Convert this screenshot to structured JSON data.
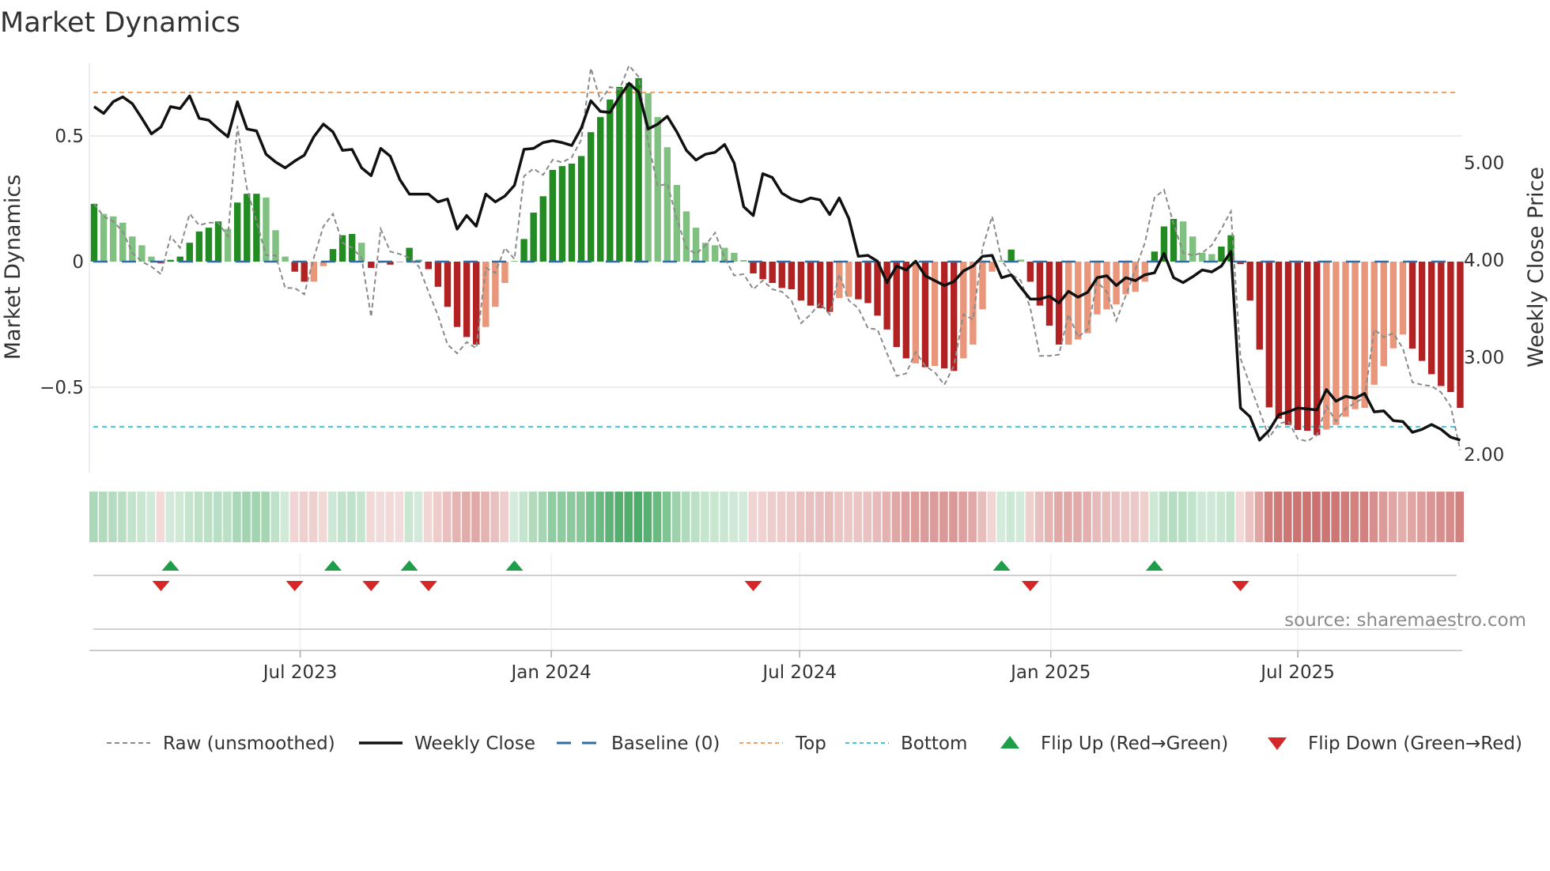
{
  "title": "Market Dynamics",
  "source": "source: sharemaestro.com",
  "colors": {
    "pos_strong": "#228b22",
    "pos_weak": "#80c080",
    "neg_strong": "#b22222",
    "neg_weak": "#e9967a",
    "raw": "#8a8a8a",
    "close": "#111111",
    "baseline": "#2e6fa3",
    "top": "#f0a060",
    "bottom": "#3fc8dc",
    "flip_up": "#1e9e48",
    "flip_down": "#d62728",
    "heat_pos": "#2e9e4f",
    "heat_neg": "#c0504d"
  },
  "chart_data": {
    "type": "bar",
    "title": "Market Dynamics",
    "ylabel": "Market Dynamics",
    "y2label": "Weekly Close Price",
    "ylim": [
      -0.79,
      0.79
    ],
    "y2lim": [
      1.93,
      6.02
    ],
    "yticks": [
      {
        "v": 0.5,
        "label": "0.5"
      },
      {
        "v": 0,
        "label": "0"
      },
      {
        "v": -0.5,
        "label": "−0.5"
      }
    ],
    "y2ticks": [
      {
        "v": 5,
        "label": "5.00"
      },
      {
        "v": 4,
        "label": "4.00"
      },
      {
        "v": 3,
        "label": "3.00"
      },
      {
        "v": 2,
        "label": "2.00"
      }
    ],
    "xticks": [
      {
        "date": "2023-07-01",
        "label": "Jul 2023"
      },
      {
        "date": "2024-01-01",
        "label": "Jan 2024"
      },
      {
        "date": "2024-07-01",
        "label": "Jul 2024"
      },
      {
        "date": "2025-01-01",
        "label": "Jan 2025"
      },
      {
        "date": "2025-07-01",
        "label": "Jul 2025"
      }
    ],
    "start_date": "2023-01-31",
    "interval": "weekly",
    "top_level": 0.673,
    "bottom_level": -0.657,
    "baseline": 0,
    "dynamics": [
      0.23,
      0.19,
      0.18,
      0.155,
      0.1,
      0.065,
      0.02,
      -0.007,
      0.007,
      0.02,
      0.075,
      0.12,
      0.135,
      0.16,
      0.13,
      0.235,
      0.27,
      0.27,
      0.255,
      0.125,
      0.02,
      -0.04,
      -0.08,
      -0.08,
      -0.018,
      0.05,
      0.105,
      0.11,
      0.075,
      -0.025,
      -0.005,
      -0.012,
      -0.003,
      0.055,
      0.008,
      -0.03,
      -0.1,
      -0.18,
      -0.26,
      -0.3,
      -0.33,
      -0.26,
      -0.18,
      -0.085,
      0.003,
      0.09,
      0.195,
      0.26,
      0.365,
      0.38,
      0.39,
      0.42,
      0.515,
      0.575,
      0.645,
      0.695,
      0.71,
      0.73,
      0.67,
      0.575,
      0.455,
      0.305,
      0.2,
      0.135,
      0.075,
      0.065,
      0.055,
      0.035,
      0.006,
      -0.047,
      -0.07,
      -0.085,
      -0.105,
      -0.11,
      -0.155,
      -0.175,
      -0.185,
      -0.2,
      -0.145,
      -0.14,
      -0.15,
      -0.165,
      -0.215,
      -0.27,
      -0.34,
      -0.385,
      -0.405,
      -0.42,
      -0.415,
      -0.425,
      -0.435,
      -0.385,
      -0.33,
      -0.19,
      -0.04,
      0.005,
      0.048,
      0.008,
      -0.08,
      -0.175,
      -0.255,
      -0.33,
      -0.33,
      -0.31,
      -0.285,
      -0.21,
      -0.19,
      -0.17,
      -0.13,
      -0.12,
      -0.08,
      0.04,
      0.14,
      0.17,
      0.16,
      0.1,
      0.035,
      0.03,
      0.06,
      0.105,
      -0.01,
      -0.155,
      -0.35,
      -0.58,
      -0.625,
      -0.65,
      -0.67,
      -0.673,
      -0.69,
      -0.668,
      -0.65,
      -0.617,
      -0.587,
      -0.582,
      -0.49,
      -0.416,
      -0.345,
      -0.29,
      -0.346,
      -0.395,
      -0.448,
      -0.495,
      -0.519,
      -0.582
    ],
    "strong": [
      1,
      0,
      0,
      0,
      0,
      0,
      0,
      1,
      1,
      1,
      1,
      1,
      1,
      1,
      0,
      1,
      1,
      1,
      0,
      0,
      0,
      1,
      1,
      0,
      0,
      1,
      1,
      1,
      0,
      1,
      0,
      1,
      0,
      1,
      0,
      1,
      1,
      1,
      1,
      1,
      1,
      0,
      0,
      0,
      0,
      1,
      1,
      1,
      1,
      1,
      1,
      1,
      1,
      1,
      1,
      1,
      1,
      1,
      0,
      0,
      0,
      0,
      0,
      0,
      0,
      0,
      0,
      0,
      0,
      1,
      1,
      1,
      1,
      1,
      1,
      1,
      1,
      1,
      0,
      0,
      1,
      1,
      1,
      1,
      1,
      1,
      0,
      1,
      0,
      1,
      1,
      0,
      0,
      0,
      0,
      0,
      1,
      0,
      1,
      1,
      1,
      1,
      0,
      0,
      0,
      0,
      0,
      0,
      0,
      0,
      0,
      1,
      1,
      1,
      0,
      0,
      0,
      0,
      1,
      1,
      1,
      1,
      1,
      1,
      1,
      1,
      1,
      1,
      1,
      0,
      0,
      0,
      0,
      0,
      0,
      0,
      0,
      0,
      1,
      1,
      1,
      1,
      1,
      1
    ],
    "raw": [
      0.23,
      0.18,
      0.16,
      0.12,
      0.035,
      0,
      -0.02,
      -0.05,
      0.1,
      0.055,
      0.19,
      0.145,
      0.155,
      0.155,
      0.1,
      0.54,
      0.29,
      0.16,
      0.025,
      0.025,
      -0.105,
      -0.105,
      -0.13,
      0.015,
      0.14,
      0.19,
      0.075,
      0.055,
      0.015,
      -0.22,
      0.13,
      0.04,
      0.03,
      0.015,
      -0.02,
      -0.12,
      -0.215,
      -0.33,
      -0.365,
      -0.32,
      -0.345,
      -0.025,
      -0.045,
      0.055,
      0.01,
      0.34,
      0.37,
      0.345,
      0.405,
      0.395,
      0.415,
      0.485,
      0.77,
      0.64,
      0.695,
      0.685,
      0.78,
      0.735,
      0.475,
      0.3,
      0.31,
      0.17,
      0.055,
      0.03,
      0.065,
      0.115,
      0.015,
      -0.055,
      -0.05,
      -0.11,
      -0.075,
      -0.11,
      -0.12,
      -0.155,
      -0.245,
      -0.21,
      -0.165,
      -0.21,
      -0.05,
      -0.155,
      -0.185,
      -0.265,
      -0.27,
      -0.365,
      -0.455,
      -0.445,
      -0.36,
      -0.415,
      -0.44,
      -0.49,
      -0.415,
      -0.21,
      -0.23,
      0.055,
      0.18,
      0.005,
      -0.05,
      -0.075,
      -0.185,
      -0.375,
      -0.375,
      -0.37,
      -0.21,
      -0.3,
      -0.27,
      -0.08,
      -0.12,
      -0.235,
      -0.135,
      -0.03,
      0.075,
      0.255,
      0.285,
      0.15,
      0.035,
      0.025,
      0.035,
      0.065,
      0.13,
      0.2,
      -0.385,
      -0.49,
      -0.595,
      -0.7,
      -0.645,
      -0.635,
      -0.705,
      -0.715,
      -0.69,
      -0.575,
      -0.635,
      -0.585,
      -0.562,
      -0.54,
      -0.27,
      -0.3,
      -0.285,
      -0.345,
      -0.48,
      -0.49,
      -0.495,
      -0.52,
      -0.575,
      -0.75
    ],
    "weekly_close": [
      5.57,
      5.5,
      5.62,
      5.67,
      5.6,
      5.45,
      5.29,
      5.36,
      5.57,
      5.55,
      5.68,
      5.45,
      5.43,
      5.34,
      5.26,
      5.62,
      5.34,
      5.32,
      5.08,
      5.0,
      4.94,
      5.01,
      5.07,
      5.26,
      5.39,
      5.31,
      5.12,
      5.13,
      4.94,
      4.86,
      5.14,
      5.06,
      4.82,
      4.67,
      4.67,
      4.67,
      4.59,
      4.62,
      4.31,
      4.45,
      4.34,
      4.67,
      4.59,
      4.65,
      4.76,
      5.13,
      5.14,
      5.2,
      5.22,
      5.2,
      5.17,
      5.35,
      5.63,
      5.52,
      5.51,
      5.67,
      5.81,
      5.72,
      5.34,
      5.39,
      5.47,
      5.31,
      5.12,
      5.02,
      5.08,
      5.1,
      5.18,
      4.99,
      4.54,
      4.45,
      4.88,
      4.84,
      4.68,
      4.62,
      4.59,
      4.63,
      4.61,
      4.46,
      4.63,
      4.42,
      4.03,
      4.04,
      3.98,
      3.76,
      3.93,
      3.89,
      3.98,
      3.83,
      3.78,
      3.73,
      3.77,
      3.88,
      3.93,
      4.03,
      4.04,
      3.81,
      3.84,
      3.71,
      3.59,
      3.59,
      3.62,
      3.55,
      3.67,
      3.61,
      3.66,
      3.81,
      3.83,
      3.73,
      3.81,
      3.78,
      3.84,
      3.86,
      4.06,
      3.81,
      3.76,
      3.82,
      3.89,
      3.87,
      3.93,
      4.08,
      2.47,
      2.38,
      2.14,
      2.24,
      2.4,
      2.43,
      2.47,
      2.46,
      2.45,
      2.66,
      2.54,
      2.59,
      2.57,
      2.62,
      2.43,
      2.44,
      2.34,
      2.33,
      2.22,
      2.25,
      2.3,
      2.25,
      2.17,
      2.14
    ],
    "flip_up_weeks": [
      8,
      25,
      33,
      44,
      95,
      111
    ],
    "flip_down_weeks": [
      7,
      21,
      29,
      35,
      69,
      98,
      120
    ],
    "legend": {
      "position": "bottom",
      "items": [
        {
          "key": "raw",
          "label": "Raw (unsmoothed)"
        },
        {
          "key": "close",
          "label": "Weekly Close"
        },
        {
          "key": "baseline",
          "label": "Baseline (0)"
        },
        {
          "key": "top",
          "label": "Top"
        },
        {
          "key": "bottom",
          "label": "Bottom"
        },
        {
          "key": "flip_up",
          "label": "Flip Up (Red→Green)"
        },
        {
          "key": "flip_down",
          "label": "Flip Down (Green→Red)"
        }
      ]
    }
  }
}
